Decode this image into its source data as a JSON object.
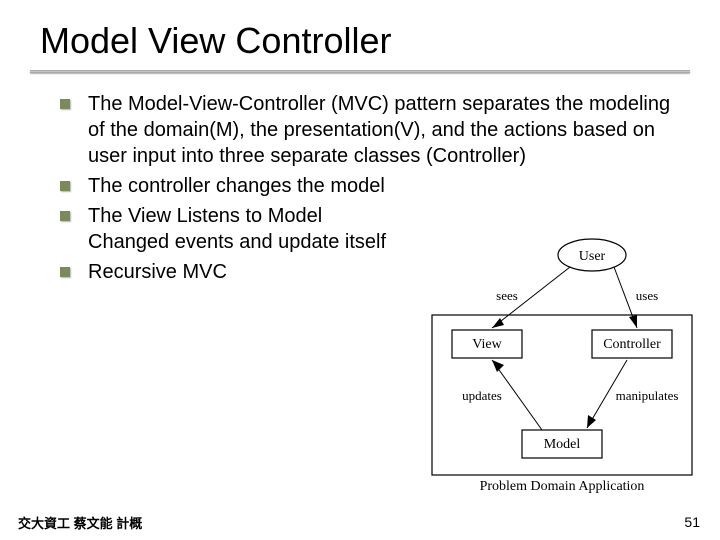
{
  "title": "Model View Controller",
  "bullets": [
    "The Model-View-Controller (MVC) pattern separates the modeling of the domain(M), the presentation(V), and the actions based on user input into three separate classes (Controller)",
    "The controller changes the model",
    "The View Listens to Model Changed events and update itself",
    "Recursive MVC"
  ],
  "diagram": {
    "user": "User",
    "view": "View",
    "controller": "Controller",
    "model": "Model",
    "caption": "Problem Domain Application",
    "edge_sees": "sees",
    "edge_uses": "uses",
    "edge_updates": "updates",
    "edge_manipulates": "manipulates"
  },
  "footer": "交大資工 蔡文能 計概",
  "page_number": "51"
}
